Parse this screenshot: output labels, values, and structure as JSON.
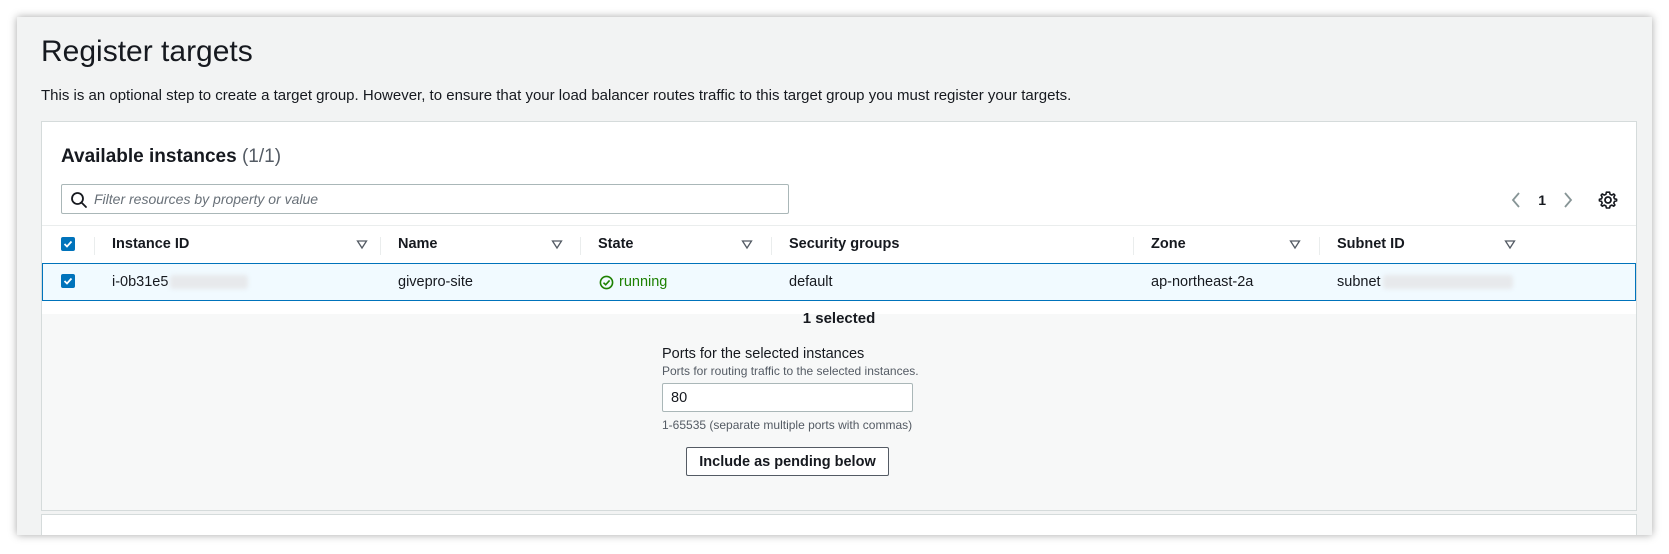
{
  "page": {
    "title": "Register targets",
    "description": "This is an optional step to create a target group. However, to ensure that your load balancer routes traffic to this target group you must register your targets."
  },
  "instances": {
    "heading": "Available instances",
    "count": "(1/1)",
    "search_placeholder": "Filter resources by property or value",
    "page_number": "1",
    "columns": [
      "Instance ID",
      "Name",
      "State",
      "Security groups",
      "Zone",
      "Subnet ID"
    ],
    "rows": [
      {
        "selected": true,
        "instance_id": "i-0b31e5",
        "name": "givepro-site",
        "state": "running",
        "security_groups": "default",
        "zone": "ap-northeast-2a",
        "subnet_id": "subnet"
      }
    ],
    "selected_text": "1 selected"
  },
  "ports": {
    "label": "Ports for the selected instances",
    "description": "Ports for routing traffic to the selected instances.",
    "value": "80",
    "hint": "1-65535 (separate multiple ports with commas)"
  },
  "actions": {
    "include_label": "Include as pending below"
  },
  "colors": {
    "accent": "#0073bb",
    "running": "#1d8102",
    "selected_row_bg": "#f1faff"
  }
}
